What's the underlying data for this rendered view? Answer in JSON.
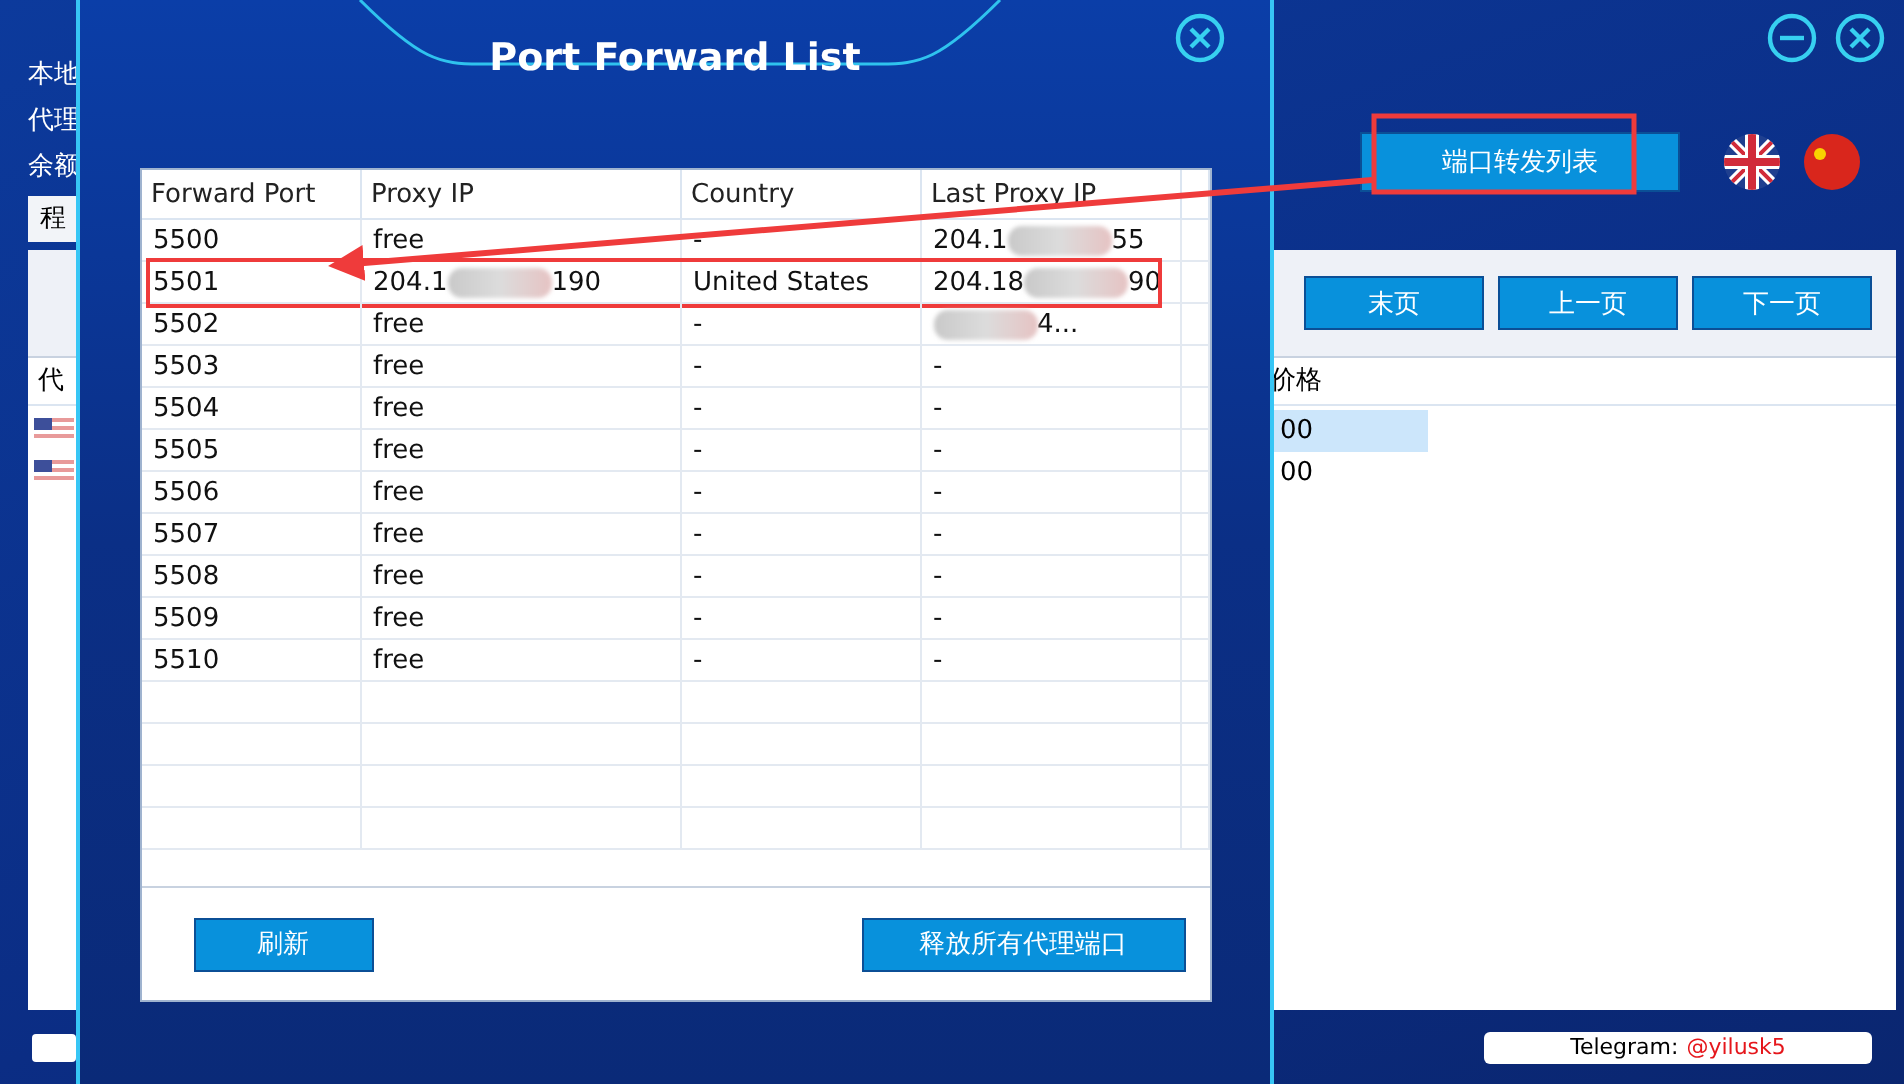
{
  "background_app": {
    "labels": [
      "本地",
      "代理",
      "余额"
    ],
    "tab": "程",
    "table_header_left": "代",
    "table_header_right": "价格",
    "rows": [
      {
        "value": "00",
        "selected": true
      },
      {
        "value": "00",
        "selected": false
      }
    ],
    "pager_buttons": [
      "末页",
      "上一页",
      "下一页"
    ],
    "forward_button": {
      "label": "端口转发列表",
      "highlighted": true
    },
    "telegram": {
      "label": "Telegram:",
      "handle": "@yilusk5"
    }
  },
  "dialog": {
    "title": "Port Forward List",
    "columns": [
      "Forward Port",
      "Proxy IP",
      "Country",
      "Last Proxy IP"
    ],
    "rows": [
      {
        "port": "5500",
        "proxy_ip": {
          "start": "free"
        },
        "country": "-",
        "last_ip": {
          "start": "204.1",
          "end": "55",
          "redacted": true
        },
        "highlighted": false
      },
      {
        "port": "5501",
        "proxy_ip": {
          "start": "204.1",
          "end": "190",
          "redacted": true
        },
        "country": "United States",
        "last_ip": {
          "start": "204.18",
          "end": "90",
          "redacted": true
        },
        "highlighted": true
      },
      {
        "port": "5502",
        "proxy_ip": {
          "start": "free"
        },
        "country": "-",
        "last_ip": {
          "end": "4...",
          "redacted": true
        },
        "highlighted": false
      },
      {
        "port": "5503",
        "proxy_ip": {
          "start": "free"
        },
        "country": "-",
        "last_ip": {
          "start": "-"
        },
        "highlighted": false
      },
      {
        "port": "5504",
        "proxy_ip": {
          "start": "free"
        },
        "country": "-",
        "last_ip": {
          "start": "-"
        },
        "highlighted": false
      },
      {
        "port": "5505",
        "proxy_ip": {
          "start": "free"
        },
        "country": "-",
        "last_ip": {
          "start": "-"
        },
        "highlighted": false
      },
      {
        "port": "5506",
        "proxy_ip": {
          "start": "free"
        },
        "country": "-",
        "last_ip": {
          "start": "-"
        },
        "highlighted": false
      },
      {
        "port": "5507",
        "proxy_ip": {
          "start": "free"
        },
        "country": "-",
        "last_ip": {
          "start": "-"
        },
        "highlighted": false
      },
      {
        "port": "5508",
        "proxy_ip": {
          "start": "free"
        },
        "country": "-",
        "last_ip": {
          "start": "-"
        },
        "highlighted": false
      },
      {
        "port": "5509",
        "proxy_ip": {
          "start": "free"
        },
        "country": "-",
        "last_ip": {
          "start": "-"
        },
        "highlighted": false
      },
      {
        "port": "5510",
        "proxy_ip": {
          "start": "free"
        },
        "country": "-",
        "last_ip": {
          "start": "-"
        },
        "highlighted": false
      }
    ],
    "buttons": [
      "刷新",
      "释放所有代理端口"
    ]
  }
}
